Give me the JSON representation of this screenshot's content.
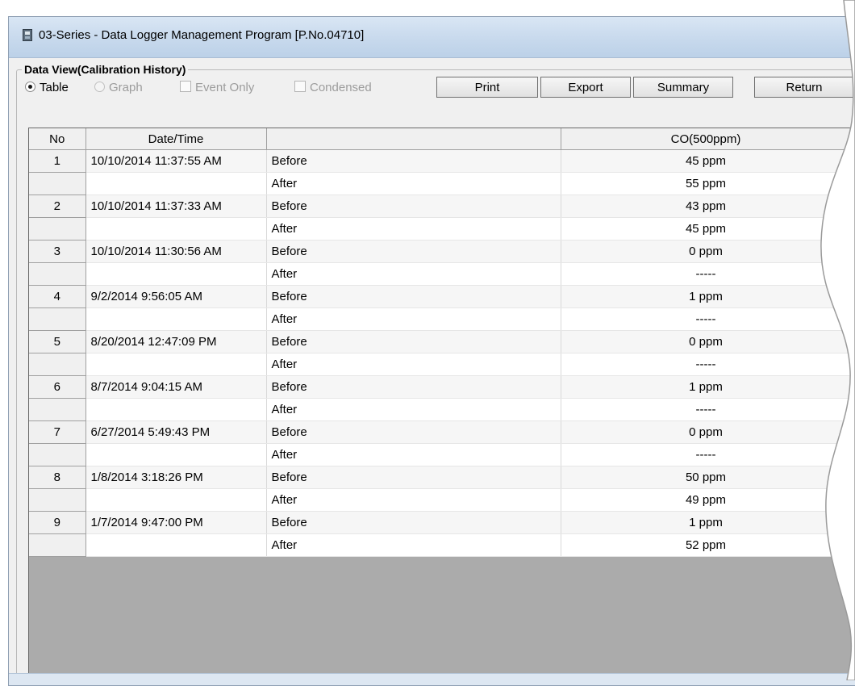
{
  "window": {
    "title": "03-Series  - Data Logger Management Program [P.No.04710]"
  },
  "group": {
    "title": "Data View(Calibration History)"
  },
  "view_options": {
    "table_label": "Table",
    "graph_label": "Graph",
    "event_only_label": "Event Only",
    "condensed_label": "Condensed",
    "selected": "Table"
  },
  "buttons": {
    "print": "Print",
    "export": "Export",
    "summary": "Summary",
    "return": "Return"
  },
  "table": {
    "headers": [
      "No",
      "Date/Time",
      "",
      "CO(500ppm)"
    ],
    "rows": [
      {
        "no": "1",
        "datetime": "10/10/2014 11:37:55 AM",
        "before": "45 ppm",
        "after": "55 ppm"
      },
      {
        "no": "2",
        "datetime": "10/10/2014 11:37:33 AM",
        "before": "43 ppm",
        "after": "45 ppm"
      },
      {
        "no": "3",
        "datetime": "10/10/2014 11:30:56 AM",
        "before": "0 ppm",
        "after": "-----"
      },
      {
        "no": "4",
        "datetime": "9/2/2014 9:56:05 AM",
        "before": "1 ppm",
        "after": "-----"
      },
      {
        "no": "5",
        "datetime": "8/20/2014 12:47:09 PM",
        "before": "0 ppm",
        "after": "-----"
      },
      {
        "no": "6",
        "datetime": "8/7/2014 9:04:15 AM",
        "before": "1 ppm",
        "after": "-----"
      },
      {
        "no": "7",
        "datetime": "6/27/2014 5:49:43 PM",
        "before": "0 ppm",
        "after": "-----"
      },
      {
        "no": "8",
        "datetime": "1/8/2014 3:18:26 PM",
        "before": "50 ppm",
        "after": "49 ppm"
      },
      {
        "no": "9",
        "datetime": "1/7/2014 9:47:00 PM",
        "before": "1 ppm",
        "after": "52 ppm"
      }
    ],
    "before_label": "Before",
    "after_label": "After"
  },
  "colors": {
    "title_bar": "#c6d8ec",
    "window_bg": "#f0f0f0",
    "empty_grid_bg": "#ababab"
  }
}
